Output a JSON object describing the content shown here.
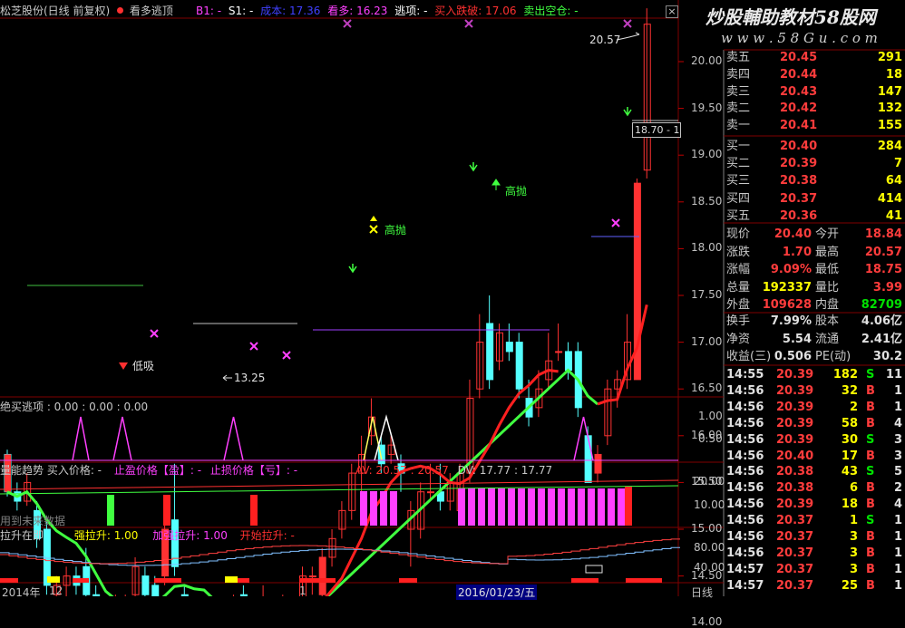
{
  "header": {
    "stock_title": "松芝股份(日线 前复权)",
    "signal_name": "看多逃顶",
    "b1": "B1: -",
    "s1": "S1: -",
    "cost": "成本: 17.36",
    "kanduo": "看多: 16.23",
    "taoding": "逃项: -",
    "buy_stop": "买入跌破: 17.06",
    "sell_empty": "卖出空仓: -",
    "close_btn": "×"
  },
  "watermark": {
    "line1": "炒股輔助教材58股网",
    "line2": "w w w . 5 8 G u . c o m"
  },
  "main_chart": {
    "price_labels": [
      "20.00",
      "19.50",
      "19.00",
      "18.50",
      "18.00",
      "17.50",
      "17.00",
      "16.50",
      "16.00",
      "15.50",
      "15.00",
      "14.50",
      "14.00"
    ],
    "high_label": "20.57",
    "low_label": "13.25",
    "low_buy_label": "低吸",
    "high_sell_label_1": "高抛",
    "high_sell_label_2": "高抛",
    "crosshair_label": "18.70 - 1"
  },
  "panel2": {
    "title": "绝买逃项 : 0.00 : 0.00 : 0.00",
    "axis": [
      "1.00",
      "0.50"
    ]
  },
  "panel3": {
    "title": "量能趋势 买入价格: -",
    "stop_profit": "止盈价格【盈】: -",
    "stop_loss": "止损价格【亏】: -",
    "av": "AV: 20.57 : 20.57",
    "dv": "DV: 17.77 : 17.77",
    "axis": [
      "20.00",
      "10.00"
    ],
    "future_note": "用到未来数据"
  },
  "panel4": {
    "title": "拉升在即",
    "strong": "强拉升: 1.00",
    "stronger": "加强拉升: 1.00",
    "start": "开始拉升: -",
    "axis": [
      "80.00",
      "40.00"
    ]
  },
  "bottom_axis": {
    "left": "2014年",
    "mid1": "12",
    "mid2": "1",
    "date": "2016/01/23/五",
    "right": "日线"
  },
  "quotes": {
    "asks": [
      {
        "label": "卖五",
        "price": "20.45",
        "vol": "291"
      },
      {
        "label": "卖四",
        "price": "20.44",
        "vol": "18"
      },
      {
        "label": "卖三",
        "price": "20.43",
        "vol": "147"
      },
      {
        "label": "卖二",
        "price": "20.42",
        "vol": "132"
      },
      {
        "label": "卖一",
        "price": "20.41",
        "vol": "155"
      }
    ],
    "bids": [
      {
        "label": "买一",
        "price": "20.40",
        "vol": "284"
      },
      {
        "label": "买二",
        "price": "20.39",
        "vol": "7"
      },
      {
        "label": "买三",
        "price": "20.38",
        "vol": "64"
      },
      {
        "label": "买四",
        "price": "20.37",
        "vol": "414"
      },
      {
        "label": "买五",
        "price": "20.36",
        "vol": "41"
      }
    ],
    "stats": [
      {
        "l1": "现价",
        "v1": "20.40",
        "l2": "今开",
        "v2": "18.84"
      },
      {
        "l1": "涨跌",
        "v1": "1.70",
        "l2": "最高",
        "v2": "20.57"
      },
      {
        "l1": "涨幅",
        "v1": "9.09%",
        "l2": "最低",
        "v2": "18.75"
      },
      {
        "l1": "总量",
        "v1": "192337",
        "l2": "量比",
        "v2": "3.99"
      },
      {
        "l1": "外盘",
        "v1": "109628",
        "l2": "内盘",
        "v2": "82709"
      }
    ],
    "stats2": [
      {
        "l1": "换手",
        "v1": "7.99%",
        "l2": "股本",
        "v2": "4.06亿"
      },
      {
        "l1": "净资",
        "v1": "5.54",
        "l2": "流通",
        "v2": "2.41亿"
      },
      {
        "l1": "收益(三)",
        "v1": "0.506",
        "l2": "PE(动)",
        "v2": "30.2"
      }
    ],
    "ticks": [
      {
        "t": "14:55",
        "p": "20.39",
        "v": "182",
        "s": "S",
        "n": "11"
      },
      {
        "t": "14:56",
        "p": "20.39",
        "v": "32",
        "s": "B",
        "n": "1"
      },
      {
        "t": "14:56",
        "p": "20.39",
        "v": "2",
        "s": "B",
        "n": "1"
      },
      {
        "t": "14:56",
        "p": "20.39",
        "v": "58",
        "s": "B",
        "n": "4"
      },
      {
        "t": "14:56",
        "p": "20.39",
        "v": "30",
        "s": "S",
        "n": "3"
      },
      {
        "t": "14:56",
        "p": "20.40",
        "v": "17",
        "s": "B",
        "n": "3"
      },
      {
        "t": "14:56",
        "p": "20.38",
        "v": "43",
        "s": "S",
        "n": "5"
      },
      {
        "t": "14:56",
        "p": "20.38",
        "v": "6",
        "s": "B",
        "n": "2"
      },
      {
        "t": "14:56",
        "p": "20.39",
        "v": "18",
        "s": "B",
        "n": "4"
      },
      {
        "t": "14:56",
        "p": "20.37",
        "v": "1",
        "s": "S",
        "n": "1"
      },
      {
        "t": "14:56",
        "p": "20.37",
        "v": "3",
        "s": "B",
        "n": "1"
      },
      {
        "t": "14:56",
        "p": "20.37",
        "v": "3",
        "s": "B",
        "n": "1"
      },
      {
        "t": "14:57",
        "p": "20.37",
        "v": "3",
        "s": "B",
        "n": "1"
      },
      {
        "t": "14:57",
        "p": "20.37",
        "v": "25",
        "s": "B",
        "n": "1"
      }
    ]
  },
  "candles": [
    [
      15.8,
      15.4,
      15.85,
      15.35
    ],
    [
      15.4,
      15.3,
      15.5,
      15.2
    ],
    [
      15.3,
      15.5,
      15.6,
      15.25
    ],
    [
      15.2,
      14.9,
      15.3,
      14.8
    ],
    [
      15.0,
      14.4,
      15.1,
      14.3
    ],
    [
      14.3,
      14.4,
      14.5,
      14.2
    ],
    [
      14.4,
      14.5,
      14.6,
      14.0
    ],
    [
      14.5,
      14.4,
      14.6,
      14.3
    ],
    [
      14.6,
      14.3,
      14.8,
      14.2
    ],
    [
      14.3,
      13.8,
      14.4,
      13.7
    ],
    [
      13.8,
      14.0,
      14.1,
      13.7
    ],
    [
      14.0,
      14.2,
      14.3,
      13.9
    ],
    [
      14.2,
      14.2,
      14.3,
      14.1
    ],
    [
      14.3,
      14.6,
      14.7,
      14.2
    ],
    [
      14.5,
      14.3,
      14.6,
      14.2
    ],
    [
      14.4,
      14.2,
      14.5,
      14.1
    ],
    [
      14.5,
      15.0,
      15.1,
      14.4
    ],
    [
      15.1,
      14.6,
      15.7,
      14.5
    ],
    [
      14.3,
      14.1,
      14.4,
      14.0
    ],
    [
      14.1,
      13.9,
      14.2,
      13.8
    ],
    [
      13.9,
      14.1,
      14.2,
      13.8
    ],
    [
      14.0,
      13.8,
      14.1,
      13.3
    ],
    [
      13.8,
      14.1,
      14.2,
      13.7
    ],
    [
      14.1,
      14.2,
      14.3,
      13.9
    ],
    [
      14.3,
      14.1,
      14.4,
      14.0
    ],
    [
      14.1,
      13.9,
      14.2,
      13.8
    ],
    [
      13.8,
      14.2,
      14.4,
      13.7
    ],
    [
      14.1,
      13.9,
      14.2,
      13.8
    ],
    [
      13.9,
      14.1,
      14.3,
      13.8
    ],
    [
      14.1,
      14.0,
      14.2,
      13.9
    ],
    [
      14.2,
      14.5,
      14.6,
      14.1
    ],
    [
      14.5,
      14.5,
      14.6,
      14.3
    ],
    [
      14.3,
      14.7,
      14.8,
      14.2
    ],
    [
      14.7,
      14.9,
      15.0,
      14.6
    ],
    [
      15.0,
      15.2,
      15.3,
      14.9
    ],
    [
      15.2,
      15.6,
      15.7,
      15.1
    ],
    [
      15.6,
      15.8,
      16.0,
      15.4
    ],
    [
      16.0,
      16.2,
      16.4,
      15.9
    ],
    [
      15.9,
      15.7,
      16.0,
      15.6
    ],
    [
      15.8,
      15.9,
      16.0,
      15.7
    ],
    [
      15.7,
      15.6,
      15.8,
      15.4
    ],
    [
      15.0,
      15.2,
      15.3,
      14.6
    ],
    [
      15.0,
      15.4,
      15.5,
      14.9
    ],
    [
      15.4,
      15.4,
      15.7,
      15.3
    ],
    [
      15.4,
      15.3,
      15.7,
      15.2
    ],
    [
      15.3,
      15.5,
      15.6,
      15.2
    ],
    [
      15.2,
      15.6,
      15.7,
      15.1
    ],
    [
      15.6,
      16.4,
      16.6,
      15.5
    ],
    [
      16.5,
      17.0,
      17.3,
      16.4
    ],
    [
      17.2,
      16.6,
      17.5,
      16.5
    ],
    [
      16.8,
      17.1,
      17.2,
      16.7
    ],
    [
      17.0,
      16.9,
      17.2,
      16.8
    ],
    [
      17.0,
      16.5,
      17.1,
      16.4
    ],
    [
      16.4,
      16.2,
      16.6,
      16.1
    ],
    [
      16.3,
      16.5,
      16.7,
      16.2
    ],
    [
      16.6,
      16.8,
      17.1,
      16.5
    ],
    [
      16.9,
      16.9,
      17.2,
      16.8
    ],
    [
      16.9,
      16.7,
      17.0,
      16.6
    ],
    [
      16.9,
      16.3,
      17.0,
      16.2
    ],
    [
      16.0,
      15.5,
      16.1,
      15.5
    ],
    [
      15.6,
      15.8,
      15.9,
      15.5
    ],
    [
      16.0,
      16.5,
      16.6,
      15.9
    ],
    [
      16.5,
      16.6,
      16.7,
      16.3
    ],
    [
      16.6,
      17.0,
      17.3,
      16.5
    ],
    [
      16.6,
      18.7,
      18.75,
      16.6
    ],
    [
      18.84,
      20.4,
      20.57,
      18.75
    ]
  ],
  "colors": {
    "up": "#ff3232",
    "down": "#54ffff",
    "ma_green": "#40ff40",
    "ma_red": "#ff2020",
    "grid": "#800000",
    "magenta": "#ff40ff"
  },
  "icons": {
    "status_dot": "red-dot-icon",
    "close": "close-icon",
    "arrow_up": "up-arrow-icon",
    "arrow_down": "down-arrow-icon",
    "cross": "cross-marker-icon"
  }
}
